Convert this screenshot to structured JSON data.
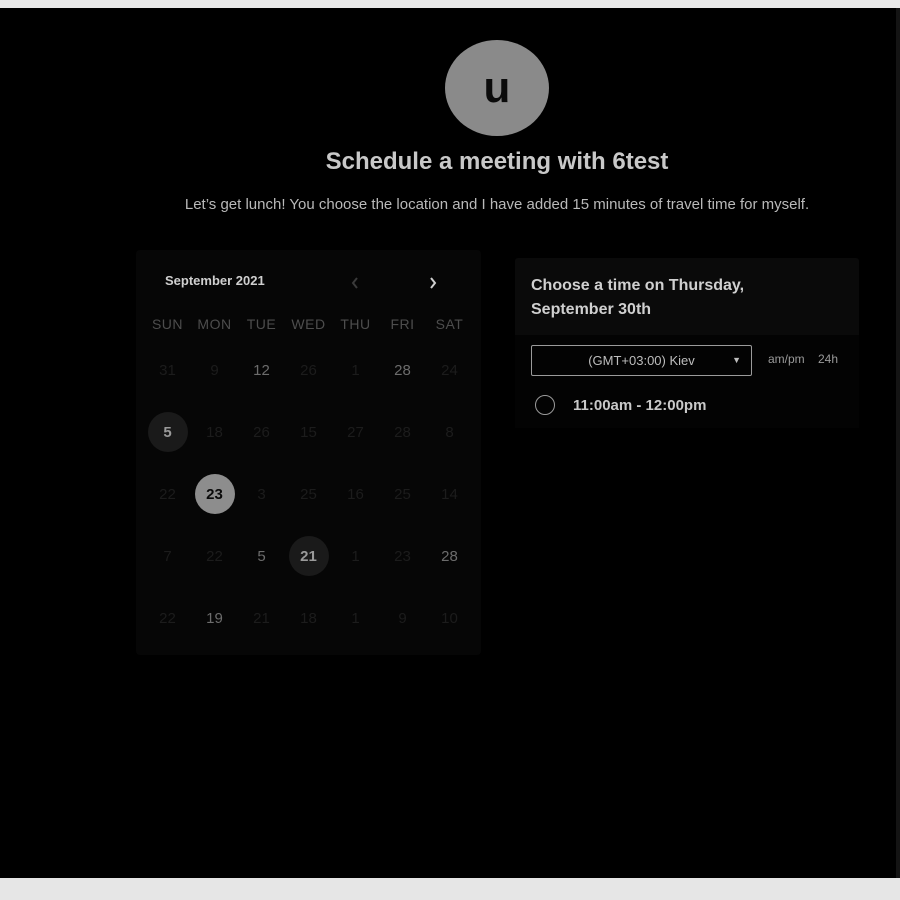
{
  "header": {
    "avatar_letter": "u",
    "title": "Schedule a meeting with 6test",
    "subtitle": "Let’s get lunch! You choose the location and I have added 15 minutes of travel time for myself."
  },
  "calendar": {
    "month_label": "September 2021",
    "prev_icon": "chevron-left-icon",
    "next_icon": "chevron-right-icon",
    "weekdays": [
      "SUN",
      "MON",
      "TUE",
      "WED",
      "THU",
      "FRI",
      "SAT"
    ],
    "weeks": [
      [
        "31",
        "9",
        "12",
        "26",
        "1",
        "28",
        "24"
      ],
      [
        "5",
        "18",
        "26",
        "15",
        "27",
        "28",
        "8"
      ],
      [
        "22",
        "23",
        "3",
        "25",
        "16",
        "25",
        "14"
      ],
      [
        "7",
        "22",
        "5",
        "21",
        "1",
        "23",
        "28"
      ],
      [
        "22",
        "19",
        "21",
        "18",
        "1",
        "9",
        "10"
      ]
    ],
    "available_days": [
      "5",
      "21"
    ],
    "selected_day": "23"
  },
  "time_picker": {
    "heading": "Choose a time on Thursday, September 30th",
    "timezone": "(GMT+03:00) Kiev",
    "format_ampm": "am/pm",
    "format_24h": "24h",
    "slots": [
      "11:00am - 12:00pm"
    ]
  },
  "colors": {
    "background": "#000000",
    "selected_day": "#8d8d8d",
    "available_day": "#1a1a1a",
    "avatar": "#8a8a8a"
  }
}
